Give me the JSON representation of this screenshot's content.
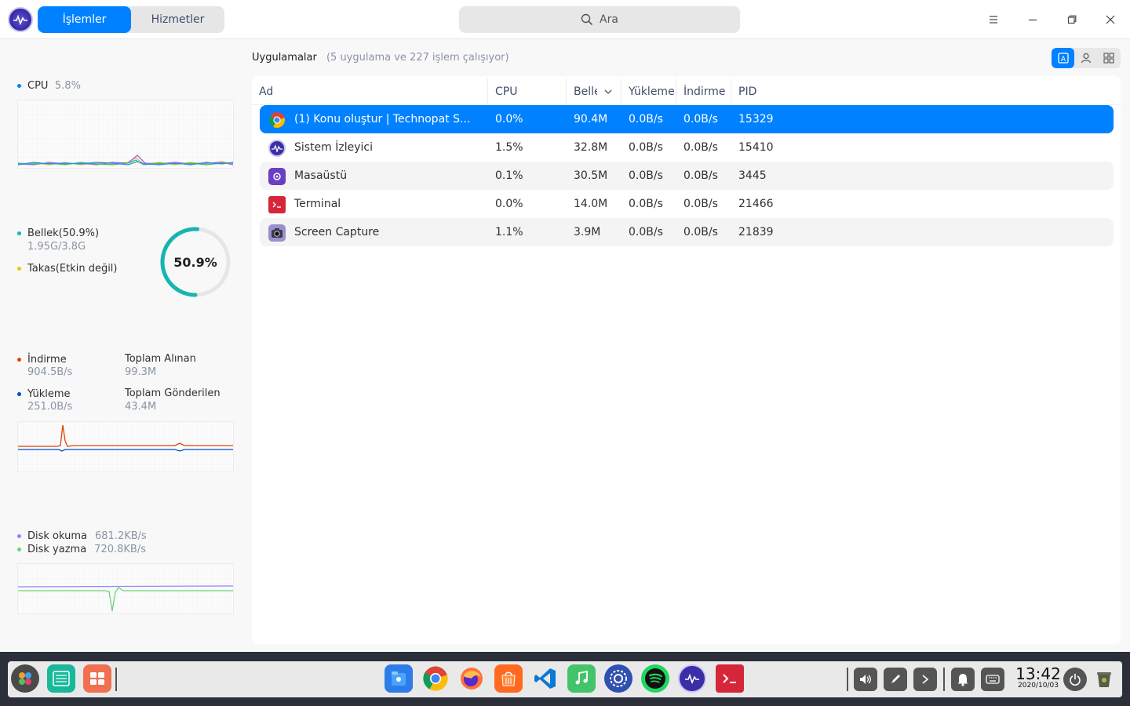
{
  "titlebar": {
    "tabs": [
      {
        "label": "İşlemler",
        "active": true
      },
      {
        "label": "Hizmetler",
        "active": false
      }
    ],
    "search_placeholder": "Ara"
  },
  "sidebar": {
    "cpu": {
      "label": "CPU",
      "value": "5.8%"
    },
    "memory": {
      "label": "Bellek(50.9%)",
      "detail": "1.95G/3.8G",
      "swap_label": "Takas(Etkin değil)",
      "ring_value": "50.9%",
      "ring_fraction": 0.509
    },
    "network": {
      "download_label": "İndirme",
      "download_value": "904.5B/s",
      "total_received_label": "Toplam Alınan",
      "total_received_value": "99.3M",
      "upload_label": "Yükleme",
      "upload_value": "251.0B/s",
      "total_sent_label": "Toplam Gönderilen",
      "total_sent_value": "43.4M"
    },
    "disk": {
      "read_label": "Disk okuma",
      "read_value": "681.2KB/s",
      "write_label": "Disk yazma",
      "write_value": "720.8KB/s"
    }
  },
  "main": {
    "title": "Uygulamalar",
    "subtitle": "(5 uygulama ve 227 işlem çalışıyor)",
    "columns": [
      "Ad",
      "CPU",
      "Bellek",
      "Yükleme",
      "İndirme",
      "PID"
    ],
    "rows": [
      {
        "name": "(1) Konu oluştur | Technopat S...",
        "cpu": "0.0%",
        "mem": "90.4M",
        "up": "0.0B/s",
        "down": "0.0B/s",
        "pid": "15329",
        "icon": "chrome-icon",
        "selected": true
      },
      {
        "name": "Sistem İzleyici",
        "cpu": "1.5%",
        "mem": "32.8M",
        "up": "0.0B/s",
        "down": "0.0B/s",
        "pid": "15410",
        "icon": "system-monitor-icon",
        "selected": false
      },
      {
        "name": "Masaüstü",
        "cpu": "0.1%",
        "mem": "30.5M",
        "up": "0.0B/s",
        "down": "0.0B/s",
        "pid": "3445",
        "icon": "desktop-icon",
        "selected": false
      },
      {
        "name": "Terminal",
        "cpu": "0.0%",
        "mem": "14.0M",
        "up": "0.0B/s",
        "down": "0.0B/s",
        "pid": "21466",
        "icon": "terminal-icon",
        "selected": false
      },
      {
        "name": "Screen Capture",
        "cpu": "1.1%",
        "mem": "3.9M",
        "up": "0.0B/s",
        "down": "0.0B/s",
        "pid": "21839",
        "icon": "screen-capture-icon",
        "selected": false
      }
    ]
  },
  "dock": {
    "time": "13:42",
    "date": "2020/10/03"
  },
  "colors": {
    "accent": "#0081ff",
    "memory_ring": "#16b5b0",
    "download": "#e14300",
    "upload": "#004ecb",
    "disk_read": "#8f88ff",
    "disk_write": "#6bd37a"
  }
}
